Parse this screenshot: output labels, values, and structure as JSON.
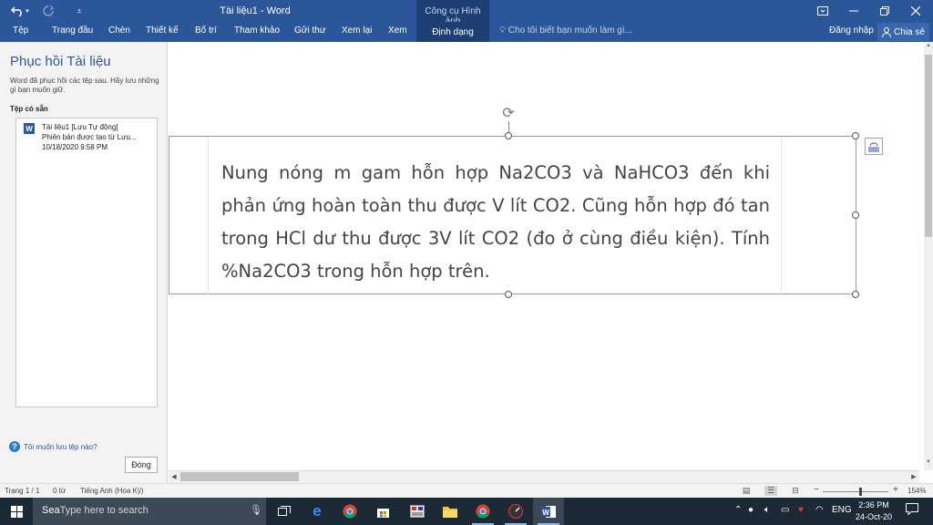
{
  "titlebar": {
    "doc_title": "Tài liệu1 - Word",
    "context_group": "Công cụ Hình ảnh",
    "undo_icon": "undo-icon",
    "redo_icon": "redo-icon"
  },
  "ribbon": {
    "tabs": [
      "Tệp",
      "Trang đầu",
      "Chèn",
      "Thiết kế",
      "Bố trí",
      "Tham khảo",
      "Gửi thư",
      "Xem lại",
      "Xem"
    ],
    "context_tab": "Định dạng",
    "tell_me": "Cho tôi biết bạn muốn làm gì...",
    "sign_in": "Đăng nhập",
    "share": "Chia sẻ"
  },
  "recovery": {
    "title": "Phục hồi Tài liệu",
    "description": "Word đã phục hồi các tệp sau.  Hãy lưu những gì bạn muốn giữ.",
    "files_label": "Tệp có sẵn",
    "file": {
      "name": "Tài liệu1  [Lưu Tự động]",
      "detail": "Phiên bản được tạo từ Lưu...",
      "date": "10/18/2020 9:58 PM"
    },
    "help_link": "Tôi muốn lưu tệp nào?",
    "close_label": "Đóng"
  },
  "document": {
    "picture_text": "Nung nóng m gam hỗn hợp Na2CO3 và NaHCO3 đến khi phản ứng hoàn toàn thu được V lít CO2. Cũng hỗn hợp đó tan trong HCl dư thu được 3V lít CO2 (đo ở cùng điều kiện). Tính %Na2CO3 trong hỗn hợp trên."
  },
  "status": {
    "page": "Trang 1 / 1",
    "words": "0 từ",
    "language": "Tiếng Anh (Hoa Kỳ)",
    "zoom": "154%"
  },
  "taskbar": {
    "search_placeholder": "Type here to search",
    "search_typed": "Sea",
    "language": "ENG",
    "time": "2:36 PM",
    "date": "24-Oct-20"
  }
}
